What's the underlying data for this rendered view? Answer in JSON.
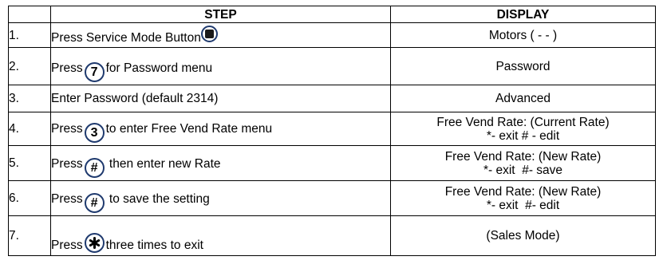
{
  "header": {
    "step": "STEP",
    "display": "DISPLAY"
  },
  "rows": [
    {
      "num": "1.",
      "pre": "Press Service Mode Button",
      "key": "service-mode",
      "post": "",
      "display": [
        "Motors ( - - )"
      ]
    },
    {
      "num": "2.",
      "pre": "Press",
      "key": "7",
      "post": "for Password menu",
      "display": [
        "Password"
      ]
    },
    {
      "num": "3.",
      "pre": "Enter Password (default 2314)",
      "key": "",
      "post": "",
      "display": [
        "Advanced"
      ]
    },
    {
      "num": "4.",
      "pre": "Press",
      "key": "3",
      "post": "to enter Free Vend Rate menu",
      "display": [
        "Free Vend Rate: (Current Rate)",
        "*- exit  # - edit"
      ]
    },
    {
      "num": "5.",
      "pre": "Press",
      "key": "#",
      "post": " then enter new Rate",
      "display": [
        "Free Vend Rate: (New Rate)",
        "*- exit  #- save"
      ]
    },
    {
      "num": "6.",
      "pre": "Press",
      "key": "#",
      "post": " to save the setting",
      "display": [
        "Free Vend Rate: (New Rate)",
        "*- exit  #- edit"
      ]
    },
    {
      "num": "7.",
      "pre": "Press",
      "key": "star",
      "post": "three times to exit",
      "display": [
        "(Sales Mode)"
      ]
    }
  ]
}
